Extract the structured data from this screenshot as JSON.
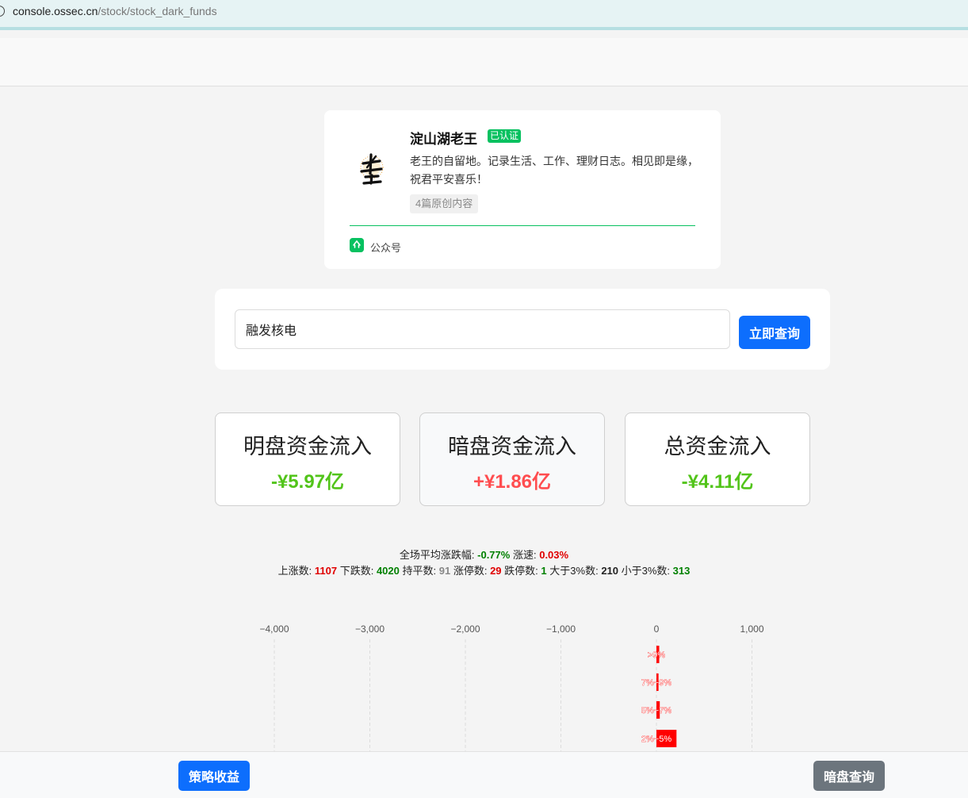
{
  "browser": {
    "url_host": "console.ossec.cn",
    "url_path": "/stock/stock_dark_funds"
  },
  "profile": {
    "name": "淀山湖老王",
    "verified_label": "已认证",
    "description": "老王的自留地。记录生活、工作、理财日志。相见即是缘，祝君平安喜乐！",
    "tag": "4篇原创内容",
    "account_type": "公众号",
    "avatar_icon": "laowang-calligraphy-avatar"
  },
  "search": {
    "value": "融发核电",
    "button_label": "立即查询"
  },
  "stats": [
    {
      "label": "明盘资金流入",
      "value": "-¥5.97亿",
      "color": "#52c41a"
    },
    {
      "label": "暗盘资金流入",
      "value": "+¥1.86亿",
      "color": "#ff4d4f"
    },
    {
      "label": "总资金流入",
      "value": "-¥4.11亿",
      "color": "#52c41a"
    }
  ],
  "market_summary": {
    "avg_change_label": "全场平均涨跌幅:",
    "avg_change": "-0.77%",
    "speed_label": "涨速:",
    "speed": "0.03%",
    "up_label": "上涨数:",
    "up": "1107",
    "down_label": "下跌数:",
    "down": "4020",
    "flat_label": "持平数:",
    "flat": "91",
    "limit_up_label": "涨停数:",
    "limit_up": "29",
    "limit_down_label": "跌停数:",
    "limit_down": "1",
    "gt3_label": "大于3%数:",
    "gt3": "210",
    "lt3_label": "小于3%数:",
    "lt3": "313",
    "colors": {
      "red": "#e00000",
      "green": "#008000",
      "gray": "#888888",
      "dark": "#222222"
    }
  },
  "chart_data": {
    "type": "bar",
    "orientation": "horizontal",
    "x_ticks": [
      -4000,
      -3000,
      -2000,
      -1000,
      0,
      1000
    ],
    "x_tick_labels": [
      "−4,000",
      "−3,000",
      "−2,000",
      "−1,000",
      "0",
      "1,000"
    ],
    "xlim": [
      -4000,
      1000
    ],
    "grid": true,
    "categories": [
      ">9%",
      "7%~9%",
      "5%~7%",
      "2%~5%"
    ],
    "values": [
      29,
      22,
      35,
      210
    ],
    "bar_color": "#ff0000"
  },
  "bottom_bar": {
    "left_button": {
      "label": "策略收益",
      "color": "#0d6efd"
    },
    "right_button": {
      "label": "暗盘查询",
      "color": "#6c757d"
    }
  }
}
